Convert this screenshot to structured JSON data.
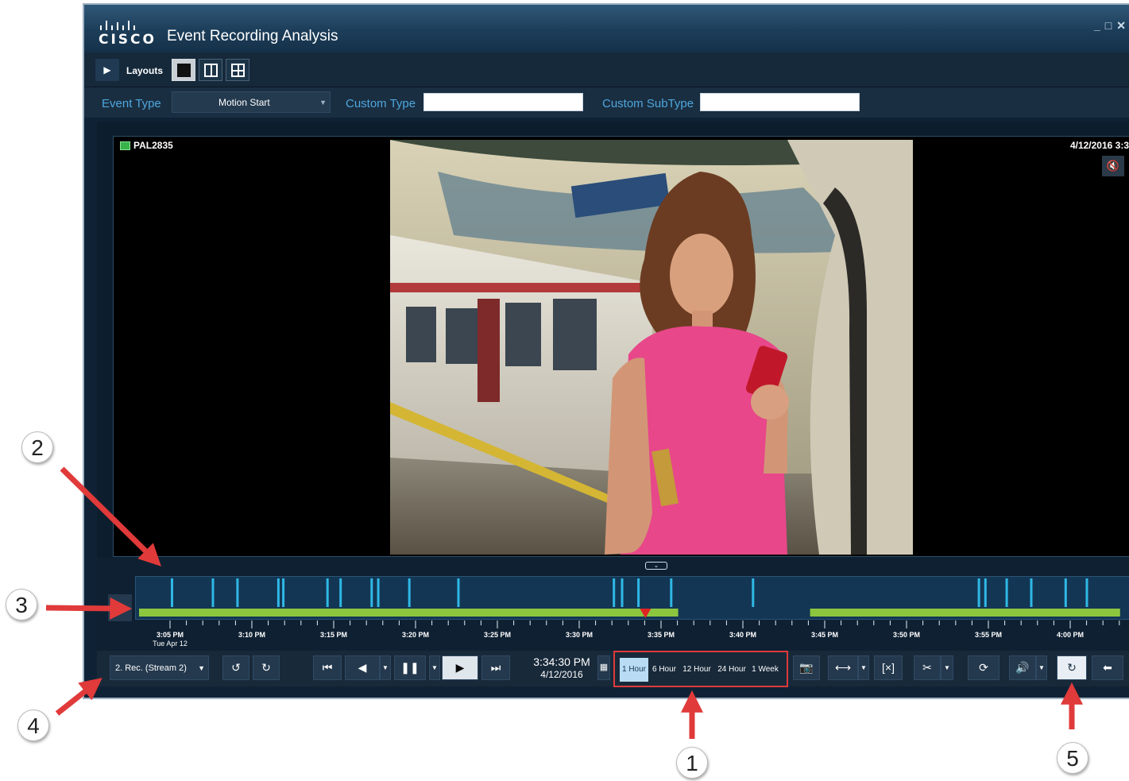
{
  "window": {
    "title": "Event Recording Analysis",
    "logo_text": "CISCO",
    "controls": [
      "_",
      "□",
      "✕"
    ]
  },
  "layouts": {
    "label": "Layouts",
    "options": [
      "single",
      "two-pane",
      "four-pane"
    ],
    "selected": "single"
  },
  "filters": {
    "event_type_label": "Event Type",
    "event_type_value": "Motion Start",
    "custom_type_label": "Custom Type",
    "custom_type_value": "",
    "custom_subtype_label": "Custom SubType",
    "custom_subtype_value": ""
  },
  "video": {
    "camera_name": "PAL2835",
    "timestamp": "4/12/2016 3:3"
  },
  "timeline": {
    "recording_segments": [
      [
        "3:05",
        "3:36"
      ],
      [
        "3:46",
        "4:03"
      ]
    ],
    "event_times": [
      "3:05.0",
      "3:07.5",
      "3:09.0",
      "3:11.5",
      "3:11.8",
      "3:14.5",
      "3:15.3",
      "3:17.2",
      "3:17.6",
      "3:19.5",
      "3:22.5",
      "3:32.0",
      "3:32.5",
      "3:33.5",
      "3:35.5",
      "3:40.5",
      "3:54.3",
      "3:54.7",
      "3:56.0",
      "3:57.5",
      "3:59.6",
      "4:00.9",
      "4:06.0"
    ],
    "playhead": "3:34:30",
    "tick_labels": [
      "3:05 PM",
      "3:10 PM",
      "3:15 PM",
      "3:20 PM",
      "3:25 PM",
      "3:30 PM",
      "3:35 PM",
      "3:40 PM",
      "3:45 PM",
      "3:50 PM",
      "3:55 PM",
      "4:00 PM"
    ],
    "date_label": "Tue Apr 12"
  },
  "controls": {
    "stream_label": "2. Rec. (Stream 2)",
    "clock_time": "3:34:30 PM",
    "clock_date": "4/12/2016",
    "zoom_options": [
      "1 Hour",
      "6 Hour",
      "12 Hour",
      "24 Hour",
      "1 Week"
    ],
    "zoom_selected": "1 Hour"
  },
  "annotations": [
    "1",
    "2",
    "3",
    "4",
    "5"
  ],
  "colors": {
    "event_marker": "#2fb8e6",
    "recording_bar": "#8cc63f",
    "playhead": "#e02424",
    "callout_arrow": "#e03a3a",
    "accent_text": "#4ea6dd"
  }
}
